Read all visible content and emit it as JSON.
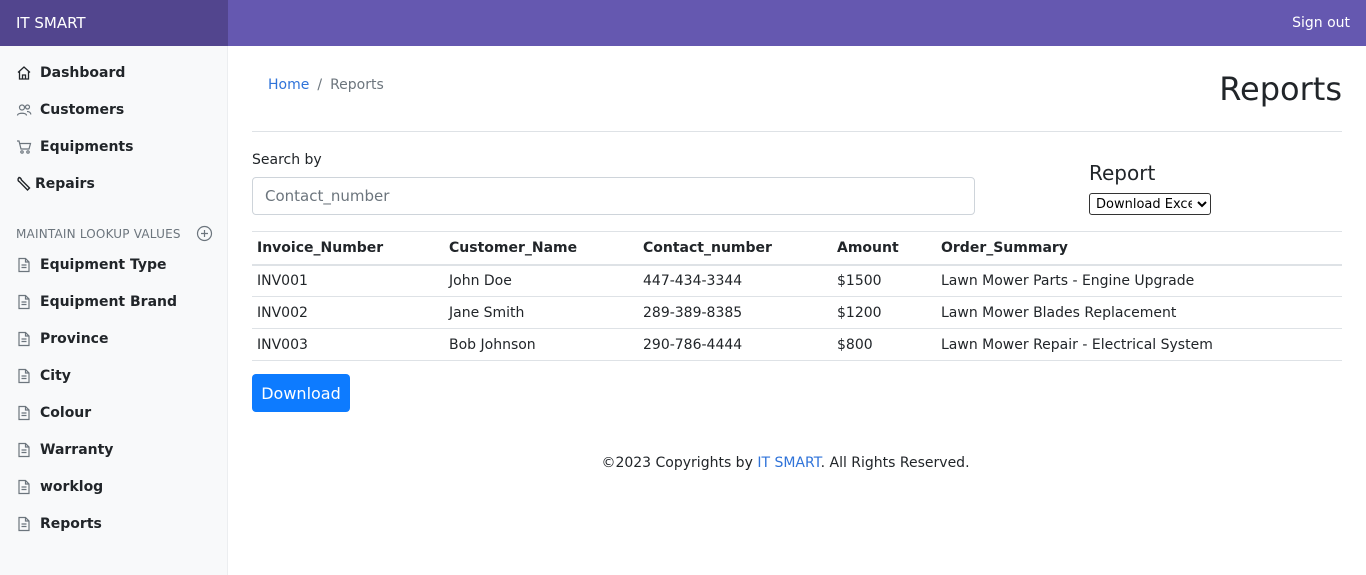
{
  "header": {
    "brand": "IT SMART",
    "sign_out": "Sign out"
  },
  "sidebar": {
    "main_items": [
      {
        "label": "Dashboard",
        "icon": "home-icon"
      },
      {
        "label": "Customers",
        "icon": "users-icon"
      },
      {
        "label": "Equipments",
        "icon": "cart-icon"
      },
      {
        "label": "Repairs",
        "icon": "wrench-icon"
      }
    ],
    "section_heading": "MAINTAIN LOOKUP VALUES",
    "lookup_items": [
      {
        "label": "Equipment Type",
        "icon": "file-icon"
      },
      {
        "label": "Equipment Brand",
        "icon": "file-icon"
      },
      {
        "label": "Province",
        "icon": "file-icon"
      },
      {
        "label": "City",
        "icon": "file-icon"
      },
      {
        "label": "Colour",
        "icon": "file-icon"
      },
      {
        "label": "Warranty",
        "icon": "file-icon"
      },
      {
        "label": "worklog",
        "icon": "file-icon"
      },
      {
        "label": "Reports",
        "icon": "file-icon"
      }
    ]
  },
  "breadcrumb": {
    "home": "Home",
    "separator": "/",
    "current": "Reports"
  },
  "page_title": "Reports",
  "search": {
    "label": "Search by",
    "placeholder": "Contact_number",
    "value": ""
  },
  "report": {
    "label": "Report",
    "selected": "Download Excel"
  },
  "table": {
    "headers": [
      "Invoice_Number",
      "Customer_Name",
      "Contact_number",
      "Amount",
      "Order_Summary"
    ],
    "rows": [
      [
        "INV001",
        "John Doe",
        "447-434-3344",
        "$1500",
        "Lawn Mower Parts - Engine Upgrade"
      ],
      [
        "INV002",
        "Jane Smith",
        "289-389-8385",
        "$1200",
        "Lawn Mower Blades Replacement"
      ],
      [
        "INV003",
        "Bob Johnson",
        "290-786-4444",
        "$800",
        "Lawn Mower Repair - Electrical System"
      ]
    ]
  },
  "download_button": "Download",
  "footer": {
    "prefix": "©2023 Copyrights by ",
    "link": "IT SMART",
    "suffix": ". All Rights Reserved."
  },
  "colors": {
    "topbar": "#6558b0",
    "brand_bg": "#52458e",
    "link": "#2f73d9",
    "primary_button": "#0d7bff"
  }
}
